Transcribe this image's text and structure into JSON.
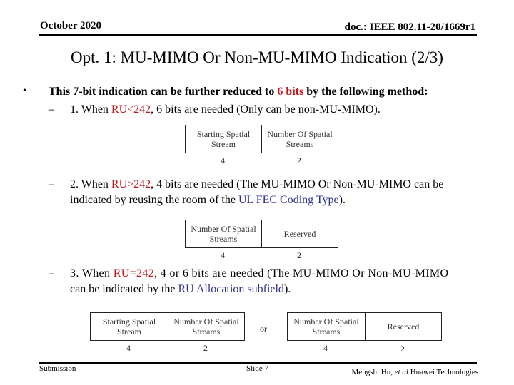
{
  "header": {
    "date": "October 2020",
    "doc_id": "doc.: IEEE 802.11-20/1669r1"
  },
  "title": "Opt. 1: MU-MIMO Or Non-MU-MIMO Indication (2/3)",
  "bullet": {
    "marker": "•",
    "text_before": "This 7-bit indication can be further reduced to ",
    "highlight": "6 bits",
    "text_after": " by the following method:"
  },
  "items": [
    {
      "dash": "–",
      "prefix": "1. When ",
      "condition": "RU<242",
      "text": ", 6 bits are needed (Only can be non-MU-MIMO).",
      "table": {
        "fields": [
          "Starting Spatial Stream",
          "Number Of Spatial Streams"
        ],
        "bits": [
          "4",
          "2"
        ]
      }
    },
    {
      "dash": "–",
      "prefix": "2. When ",
      "condition": "RU>242",
      "text": ", 4 bits are needed (The MU-MIMO Or Non-MU-MIMO can be",
      "text_line2_before": "indicated by reusing the room of the ",
      "link": "UL FEC Coding Type",
      "text_line2_after": ").",
      "table": {
        "fields": [
          "Number Of Spatial Streams",
          "Reserved"
        ],
        "bits": [
          "4",
          "2"
        ]
      }
    },
    {
      "dash": "–",
      "prefix": "3. When ",
      "condition": "RU=242",
      "text": ", 4 or 6 bits are needed (The MU-MIMO Or Non-MU-MIMO",
      "text_line2_before": "can be indicated by the ",
      "link": "RU Allocation subfield",
      "text_line2_after": ").",
      "table_a": {
        "fields": [
          "Starting Spatial Stream",
          "Number Of Spatial Streams"
        ],
        "bits": [
          "4",
          "2"
        ]
      },
      "separator": "or",
      "table_b": {
        "fields": [
          "Number Of Spatial Streams",
          "Reserved"
        ],
        "bits": [
          "4",
          "2"
        ]
      }
    }
  ],
  "footer": {
    "left": "Submission",
    "center": "Slide 7",
    "author": "Mengshi Hu, ",
    "etal": "et al",
    "org": " Huawei Technologies"
  },
  "colors": {
    "highlight_red": "#c0161d",
    "link_blue": "#2e2f8f"
  }
}
